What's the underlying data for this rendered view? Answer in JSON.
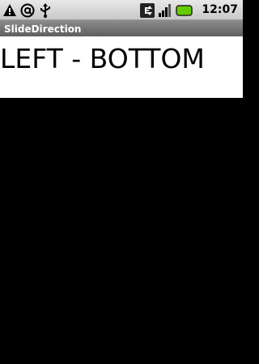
{
  "status_bar": {
    "left_icons": [
      "warning-icon",
      "at-sign-icon",
      "usb-icon"
    ],
    "right_icons": [
      "data-network-icon",
      "signal-strength-icon",
      "battery-icon"
    ],
    "network_letter": "E",
    "time": "12:07"
  },
  "app": {
    "title": "SlideDirection"
  },
  "main": {
    "direction_label": "LEFT - BOTTOM"
  },
  "colors": {
    "background": "#000000",
    "panel": "#ffffff",
    "title_bar": "#6f6f6f",
    "battery": "#66cc00"
  }
}
